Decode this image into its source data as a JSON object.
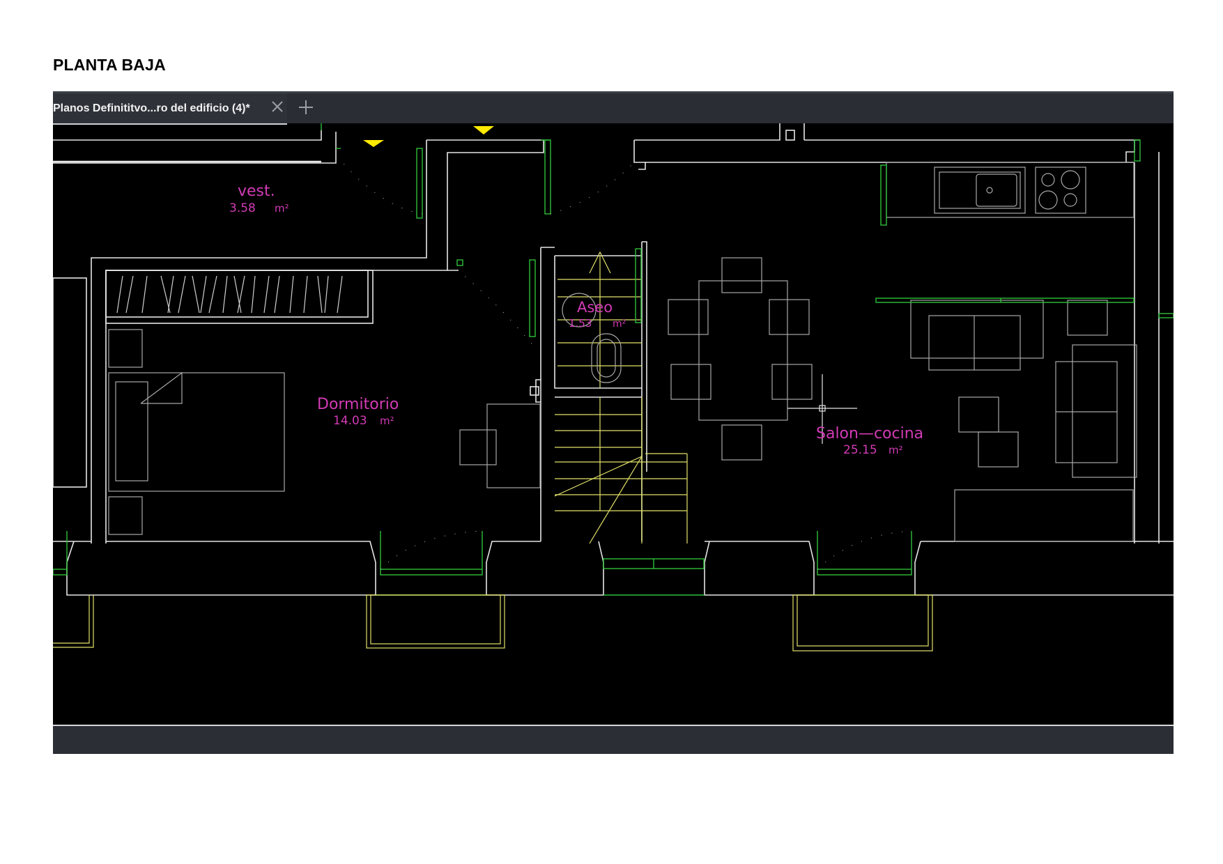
{
  "page": {
    "heading": "PLANTA BAJA"
  },
  "cad": {
    "tab": {
      "title": "Planos Definititvo...ro del edificio (4)*",
      "close_icon": "close-icon",
      "add_icon": "plus-icon"
    },
    "colors": {
      "walls": "#e6e6e6",
      "windows": "#2fbf3a",
      "stairs": "#e2e26a",
      "labels": "#d23bb5",
      "background": "#000000",
      "markers": "#ffea00"
    },
    "rooms": [
      {
        "name": "vest.",
        "area": "3.58",
        "unit": "m²"
      },
      {
        "name": "Dormitorio",
        "area": "14.03",
        "unit": "m²"
      },
      {
        "name": "Aseo",
        "area": "1.53",
        "unit": "m²"
      },
      {
        "name": "Salon—cocina",
        "area": "25.15",
        "unit": "m²"
      }
    ]
  }
}
